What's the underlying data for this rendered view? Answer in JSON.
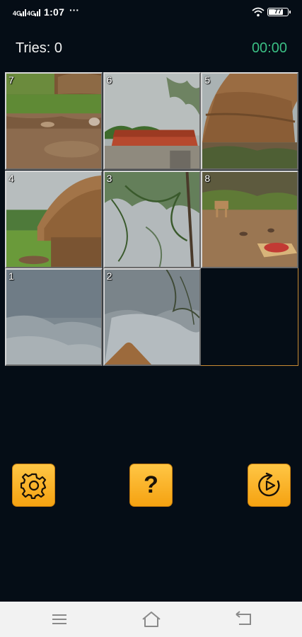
{
  "status_bar": {
    "time": "1:07",
    "overflow_dots": "···",
    "battery_level": "77"
  },
  "header": {
    "tries_label": "Tries: 0",
    "timer": "00:00"
  },
  "board": {
    "grid_size": 3,
    "tiles": [
      {
        "number": "7",
        "slot": 0,
        "scene": "village-ground"
      },
      {
        "number": "6",
        "slot": 1,
        "scene": "house-roof"
      },
      {
        "number": "5",
        "slot": 2,
        "scene": "hut-closeup"
      },
      {
        "number": "4",
        "slot": 3,
        "scene": "hut-field"
      },
      {
        "number": "3",
        "slot": 4,
        "scene": "tree-sky"
      },
      {
        "number": "8",
        "slot": 5,
        "scene": "goat-yard"
      },
      {
        "number": "1",
        "slot": 6,
        "scene": "cloudy-sky"
      },
      {
        "number": "2",
        "slot": 7,
        "scene": "sky-hut-tip"
      }
    ],
    "empty_slot": 8
  },
  "controls": {
    "settings_icon": "gear-icon",
    "help_label": "?",
    "restart_icon": "restart-play-icon"
  },
  "colors": {
    "background": "#050d16",
    "timer": "#3bbf84",
    "button": "#f9b22a",
    "empty_border": "#c78a33"
  },
  "nav_bar": {
    "menu_icon": "menu-icon",
    "home_icon": "home-icon",
    "back_icon": "back-icon"
  }
}
